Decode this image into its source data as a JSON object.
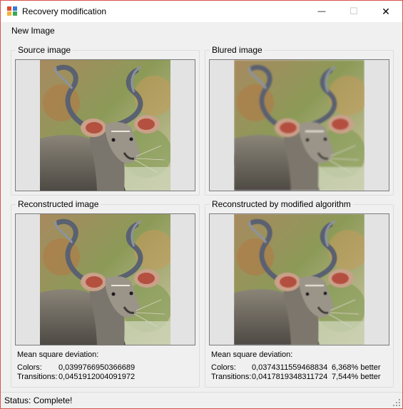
{
  "window": {
    "title": "Recovery modification",
    "app_icon": "app-icon",
    "controls": {
      "minimize": "—",
      "maximize": "☐",
      "close": "✕"
    }
  },
  "menu": {
    "new_image": "New Image"
  },
  "panels": {
    "source": {
      "title": "Source image"
    },
    "blured": {
      "title": "Blured image"
    },
    "reconstructed": {
      "title": "Reconstructed image"
    },
    "modified": {
      "title": "Reconstructed by modified algorithm"
    }
  },
  "stats_left": {
    "heading": "Mean square deviation:",
    "colors_label": "Colors:",
    "colors_value": "0,0399766950366689",
    "transitions_label": "Transitions:",
    "transitions_value": "0,0451912004091972"
  },
  "stats_right": {
    "heading": "Mean square deviation:",
    "colors_label": "Colors:",
    "colors_value": "0,0374311559468834",
    "colors_improvement": "6,368% better",
    "transitions_label": "Transitions:",
    "transitions_value": "0,0417819348311724",
    "transitions_improvement": "7,544% better"
  },
  "status": {
    "text": "Status: Complete!"
  }
}
